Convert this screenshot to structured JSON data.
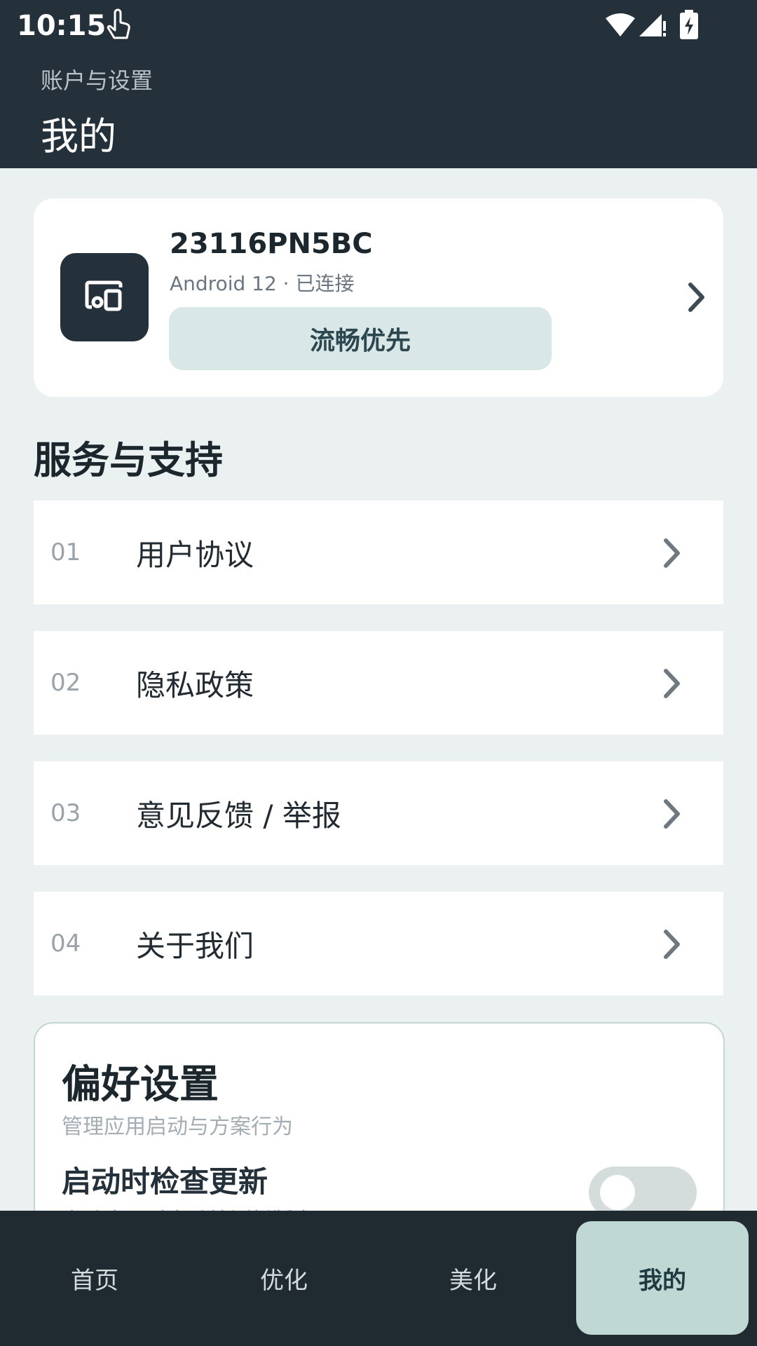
{
  "status_bar": {
    "time": "10:15",
    "icons": [
      "touch-icon",
      "wifi-icon",
      "signal-icon",
      "battery-icon"
    ]
  },
  "header": {
    "subtitle": "账户与设置",
    "title": "我的"
  },
  "device_card": {
    "name": "23116PN5BC",
    "info": "Android 12 · 已连接",
    "mode_button": "流畅优先",
    "icon": "device-icon"
  },
  "services": {
    "title": "服务与支持",
    "items": [
      {
        "num": "01",
        "label": "用户协议"
      },
      {
        "num": "02",
        "label": "隐私政策"
      },
      {
        "num": "03",
        "label": "意见反馈 / 举报"
      },
      {
        "num": "04",
        "label": "关于我们"
      }
    ]
  },
  "preferences": {
    "title": "偏好设置",
    "desc": "管理应用启动与方案行为",
    "setting_title": "启动时检查更新",
    "setting_desc": "启动应用时自动检测新版本",
    "toggle_on": false
  },
  "bottom_nav": {
    "items": [
      "首页",
      "优化",
      "美化",
      "我的"
    ],
    "active": "我的"
  },
  "colors": {
    "header_bg": "#25313A",
    "page_bg": "#EBF1F1",
    "accent": "#BFD8D3",
    "mode_button_bg": "#D9E8E6"
  }
}
